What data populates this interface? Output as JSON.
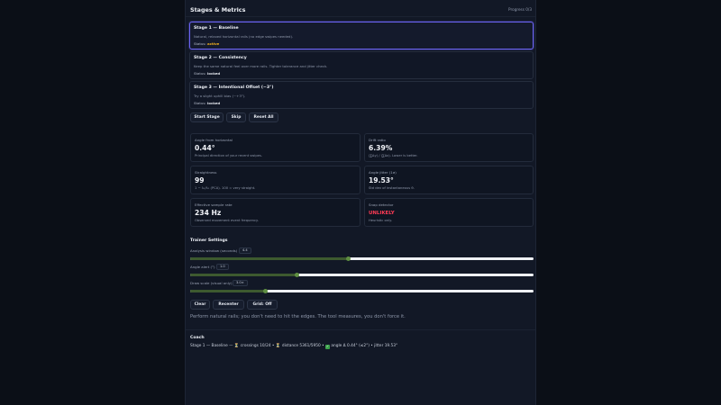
{
  "header": {
    "title": "Stages & Metrics",
    "progress": "Progress 0/3"
  },
  "stages": [
    {
      "title": "Stage 1 — Baseline",
      "desc": "Natural, relaxed horizontal rails (no edge swipes needed).",
      "status_label": "Status:",
      "status": "active"
    },
    {
      "title": "Stage 2 — Consistency",
      "desc": "Keep the same natural feel over more rails. Tighter tolerance and jitter check.",
      "status_label": "Status:",
      "status": "locked"
    },
    {
      "title": "Stage 3 — Intentional Offset (~3°)",
      "desc": "Try a slight uphill bias (~+3°).",
      "status_label": "Status:",
      "status": "locked"
    }
  ],
  "controls": {
    "start": "Start Stage",
    "skip": "Skip",
    "reset": "Reset All"
  },
  "metrics": [
    {
      "label": "Angle from horizontal",
      "value": "0.44°",
      "hint": "Principal direction of your recent swipes."
    },
    {
      "label": "Drift ratio",
      "value": "6.39%",
      "hint": "(∑Δy) / (∑Δx). Lower is better."
    },
    {
      "label": "Straightness",
      "value": "99",
      "hint": "1 − λ₂/λ₁ (PCA). 100 = very straight."
    },
    {
      "label": "Angle jitter (1σ)",
      "value": "19.53°",
      "hint": "Std dev of instantaneous θ."
    },
    {
      "label": "Effective sample rate",
      "value": "234 Hz",
      "hint": "Observed movement event frequency."
    },
    {
      "label": "Snap detector",
      "value": "UNLIKELY",
      "hint": "Heuristic only."
    }
  ],
  "trainer": {
    "title": "Trainer Settings",
    "sliders": [
      {
        "label": "Analysis window (seconds)",
        "value_text": "4.4",
        "fraction": 0.46
      },
      {
        "label": "Angle alert (°)",
        "value_text": "1.0",
        "fraction": 0.31
      },
      {
        "label": "Draw scale (visual only)",
        "value_text": "3.0×",
        "fraction": 0.22
      }
    ],
    "buttons": {
      "clear": "Clear",
      "recenter": "Recenter",
      "grid": "Grid: Off"
    }
  },
  "tip": "Perform natural rails; you don't need to hit the edges. The tool measures, you don't force it.",
  "coach": {
    "title": "Coach",
    "stage": "Stage 1 — Baseline —",
    "crossings": "crossings 10/24 •",
    "distance": "distance 5361/5950 •",
    "angle": "angle Δ 0.44° (≤2°) • jitter 19.53°",
    "icons": [
      "hourglass-icon",
      "hourglass-icon",
      "check-icon"
    ]
  },
  "colors": {
    "accent": "#6b63f2",
    "active": "#f2b01e",
    "danger": "#ff3b55",
    "slider_fill": "#3d5a2f"
  }
}
